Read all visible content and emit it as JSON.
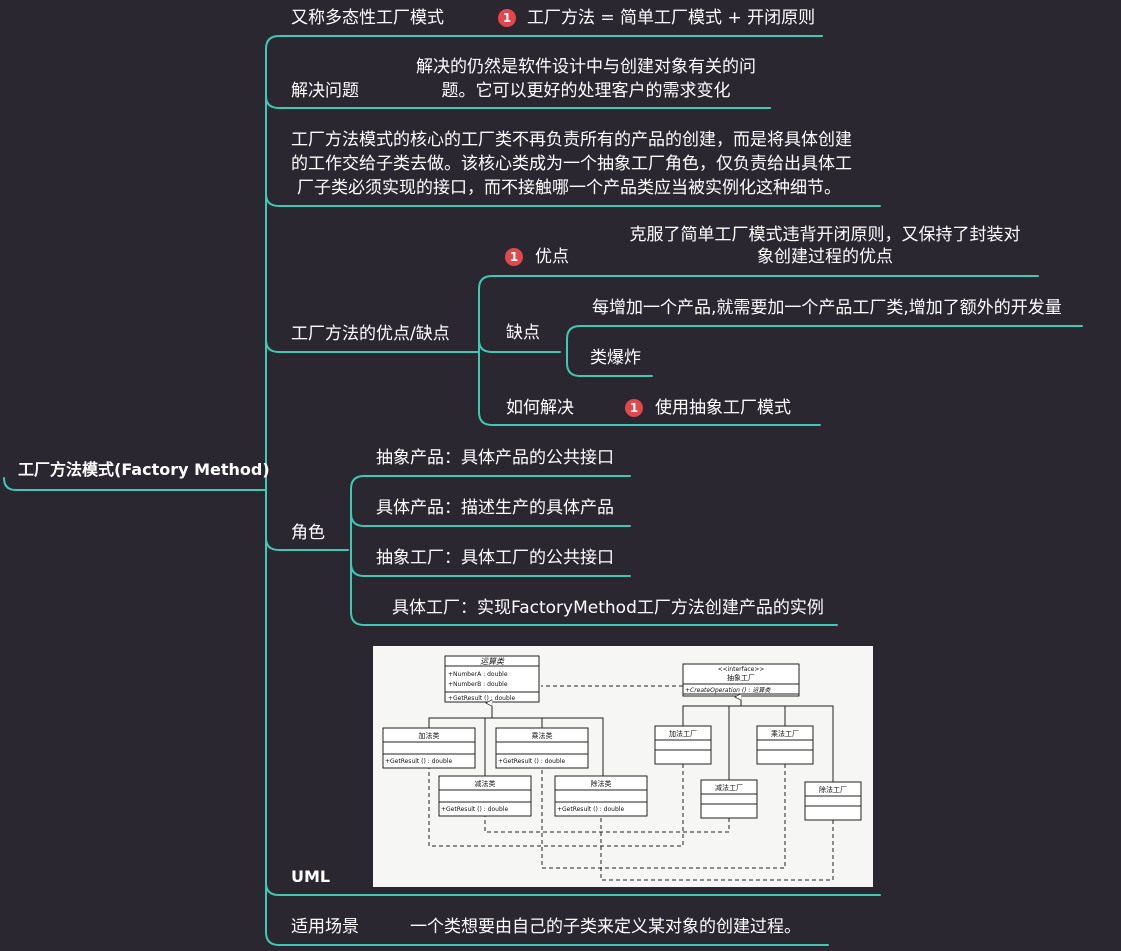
{
  "colors": {
    "background": "#2b2730",
    "connector": "#40c8b4",
    "text": "#ffffff",
    "badge": "#e0484c"
  },
  "root": {
    "label": "工厂方法模式(Factory Method)"
  },
  "branches": {
    "alias": {
      "label": "又称多态性工厂模式",
      "badge": "1",
      "formula": "工厂方法 = 简单工厂模式 + 开闭原则"
    },
    "problem": {
      "label": "解决问题",
      "text_line1": "解决的仍然是软件设计中与创建对象有关的问",
      "text_line2": "题。它可以更好的处理客户的需求变化"
    },
    "core": {
      "line1": "工厂方法模式的核心的工厂类不再负责所有的产品的创建，而是将具体创建",
      "line2": "的工作交给子类去做。该核心类成为一个抽象工厂角色，仅负责给出具体工",
      "line3": "厂子类必须实现的接口，而不接触哪一个产品类应当被实例化这种细节。"
    },
    "pros_cons": {
      "label": "工厂方法的优点/缺点",
      "pros": {
        "badge": "1",
        "label": "优点",
        "text_line1": "克服了简单工厂模式违背开闭原则，又保持了封装对",
        "text_line2": "象创建过程的优点"
      },
      "cons": {
        "label": "缺点",
        "items": [
          "每增加一个产品,就需要加一个产品工厂类,增加了额外的开发量",
          "类爆炸"
        ]
      },
      "solution": {
        "label": "如何解决",
        "badge": "1",
        "text": "使用抽象工厂模式"
      }
    },
    "roles": {
      "label": "角色",
      "items": [
        "抽象产品：具体产品的公共接口",
        "具体产品：描述生产的具体产品",
        "抽象工厂：具体工厂的公共接口",
        "具体工厂：实现FactoryMethod工厂方法创建产品的实例"
      ]
    },
    "uml": {
      "label": "UML",
      "diagram": {
        "operation": {
          "name": "运算类",
          "attr1": "+NumberA  : double",
          "attr2": "+NumberB  : double",
          "method": "+GetResult ()  : double"
        },
        "add": {
          "name": "加法类",
          "method": "+GetResult ()  : double"
        },
        "mul": {
          "name": "乘法类",
          "method": "+GetResult ()  : double"
        },
        "sub": {
          "name": "减法类",
          "method": "+GetResult ()  : double"
        },
        "div": {
          "name": "除法类",
          "method": "+GetResult ()  : double"
        },
        "factory_if": {
          "stereotype": "<<interface>>",
          "name": "抽象工厂",
          "method": "+CreateOperation ()  : 运算类"
        },
        "add_factory": "加法工厂",
        "mul_factory": "乘法工厂",
        "sub_factory": "减法工厂",
        "div_factory": "除法工厂"
      }
    },
    "scenario": {
      "label": "适用场景",
      "text": "一个类想要由自己的子类来定义某对象的创建过程。"
    }
  }
}
